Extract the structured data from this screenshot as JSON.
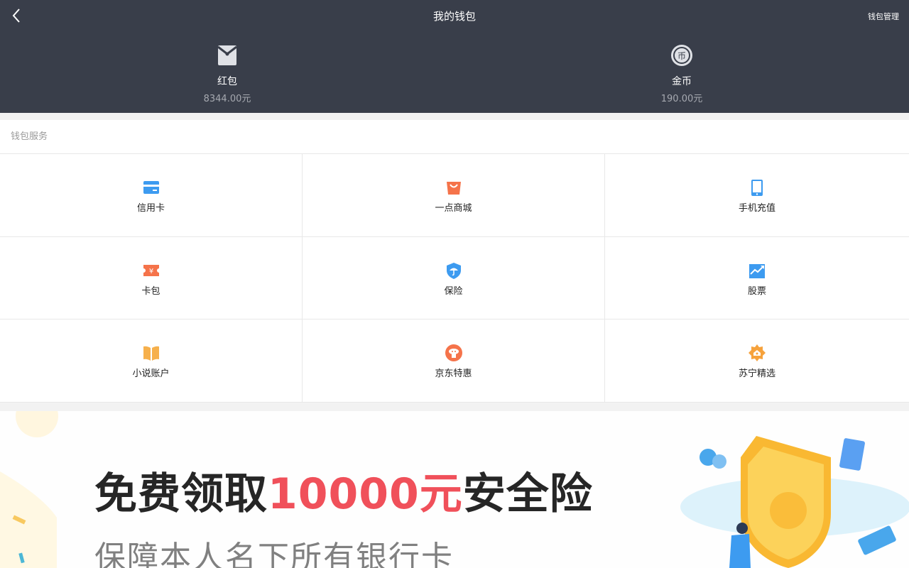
{
  "header": {
    "title": "我的钱包",
    "manage_label": "钱包管理"
  },
  "assets": [
    {
      "icon": "red-packet-icon",
      "name": "红包",
      "value": "8344.00元"
    },
    {
      "icon": "coin-icon",
      "name": "金币",
      "value": "190.00元"
    }
  ],
  "services": {
    "title": "钱包服务",
    "items": [
      {
        "icon": "credit-card-icon",
        "label": "信用卡",
        "color": "#3d9bf0"
      },
      {
        "icon": "shopping-bag-icon",
        "label": "一点商城",
        "color": "#f5734a"
      },
      {
        "icon": "mobile-phone-icon",
        "label": "手机充值",
        "color": "#3d9bf0"
      },
      {
        "icon": "coupon-icon",
        "label": "卡包",
        "color": "#f5734a"
      },
      {
        "icon": "shield-umbrella-icon",
        "label": "保险",
        "color": "#3d9bf0"
      },
      {
        "icon": "stock-chart-icon",
        "label": "股票",
        "color": "#3d9bf0"
      },
      {
        "icon": "book-icon",
        "label": "小说账户",
        "color": "#f6b04c"
      },
      {
        "icon": "jd-dog-icon",
        "label": "京东特惠",
        "color": "#f5734a"
      },
      {
        "icon": "suning-flower-icon",
        "label": "苏宁精选",
        "color": "#f6a23c"
      }
    ]
  },
  "banner": {
    "main_prefix": "免费领取",
    "main_amount": "10000元",
    "main_suffix": "安全险",
    "subtitle": "保障本人名下所有银行卡",
    "accent_color": "#f0505a"
  }
}
